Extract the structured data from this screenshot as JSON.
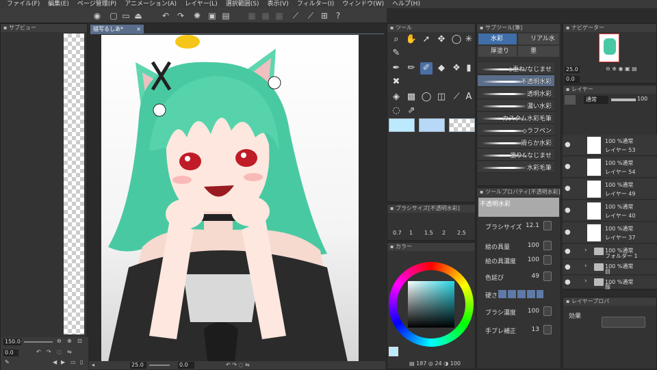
{
  "menu": [
    "ファイル(F)",
    "編集(E)",
    "ページ管理(P)",
    "アニメーション(A)",
    "レイヤー(L)",
    "選択範囲(S)",
    "表示(V)",
    "フィルター(I)",
    "ウィンドウ(W)",
    "ヘルプ(H)"
  ],
  "subview": {
    "tab": "サブビュー",
    "zoom": "150.0",
    "angle": "0.0"
  },
  "document": {
    "tab": "描写るしあ*",
    "zoom": "25.0",
    "angle": "0.0"
  },
  "tool_panel": {
    "tab": "ツール"
  },
  "subtool": {
    "tab": "サブツール[筆]",
    "tabs": [
      "水彩",
      "リアル水彩",
      "厚塗り",
      "墨"
    ],
    "brushes": [
      "◇重ね/なじませ",
      "不透明水彩",
      "透明水彩",
      "濃い水彩",
      "カスタム水彩毛筆",
      "◇ラフペン",
      "滑らか水彩",
      "塗り&なじませ",
      "水彩毛筆"
    ]
  },
  "brush_size_panel": {
    "tab": "ブラシサイズ[不透明水彩]",
    "sizes": [
      "0.7",
      "1",
      "1.5",
      "2",
      "2.5"
    ]
  },
  "color_panel": {
    "tab": "カラー",
    "readout_left": "187",
    "readout_mid": "24",
    "readout_right": "100"
  },
  "tool_property": {
    "tab": "ツールプロパティ[不透明水彩]",
    "preview_label": "不透明水彩",
    "rows": [
      {
        "label": "ブラシサイズ",
        "value": "12.1"
      },
      {
        "label": "絵の具量",
        "value": "100"
      },
      {
        "label": "絵の具濃度",
        "value": "100"
      },
      {
        "label": "色延び",
        "value": "49"
      },
      {
        "label": "硬さ",
        "value": ""
      },
      {
        "label": "ブラシ濃度",
        "value": "100"
      },
      {
        "label": "手ブレ補正",
        "value": "13"
      }
    ]
  },
  "navigator": {
    "tab": "ナビゲーター",
    "zoom": "25.0",
    "angle": "0.0"
  },
  "layer_panel": {
    "tab": "レイヤー",
    "blend": "通常",
    "opacity": "100",
    "layers": [
      {
        "l1": "100 %通常",
        "l2": "レイヤー 53"
      },
      {
        "l1": "100 %通常",
        "l2": "レイヤー 54"
      },
      {
        "l1": "100 %通常",
        "l2": "レイヤー 49"
      },
      {
        "l1": "100 %通常",
        "l2": "レイヤー 40"
      },
      {
        "l1": "100 %通常",
        "l2": "レイヤー 37"
      },
      {
        "l1": "100 %通常",
        "l2": "フォルダー 1"
      },
      {
        "l1": "100 %通常",
        "l2": "目"
      },
      {
        "l1": "100 %通常",
        "l2": "服"
      }
    ]
  },
  "layer_property": {
    "tab": "レイヤープロパ",
    "effect": "効果"
  }
}
